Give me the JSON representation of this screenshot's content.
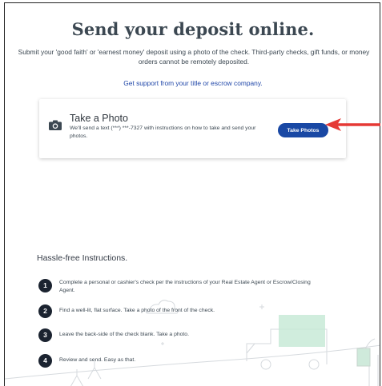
{
  "header": {
    "title": "Send your deposit online.",
    "subtitle": "Submit your 'good faith' or 'earnest money' deposit using a photo of the check. Third-party checks, gift funds, or money orders cannot be remotely deposited.",
    "support_link": "Get support from your title or escrow company."
  },
  "photo_card": {
    "title": "Take a Photo",
    "description": "We'll send a text (***) ***-7327 with instructions on how to take and send your photos.",
    "button_label": "Take Photos",
    "icon": "camera-icon"
  },
  "instructions": {
    "title": "Hassle-free Instructions.",
    "steps": [
      {
        "number": "1",
        "text": "Complete a personal or cashier's check per the instructions of your Real Estate Agent or Escrow/Closing Agent."
      },
      {
        "number": "2",
        "text": "Find a well-lit, flat surface. Take a photo of the front of the check."
      },
      {
        "number": "3",
        "text": "Leave the back-side of the check blank. Take a photo."
      },
      {
        "number": "4",
        "text": "Review and send. Easy as that."
      }
    ]
  },
  "colors": {
    "accent": "#1948a4",
    "annotation_arrow": "#e53935",
    "link": "#1f46a8",
    "step_badge": "#1b2330"
  }
}
